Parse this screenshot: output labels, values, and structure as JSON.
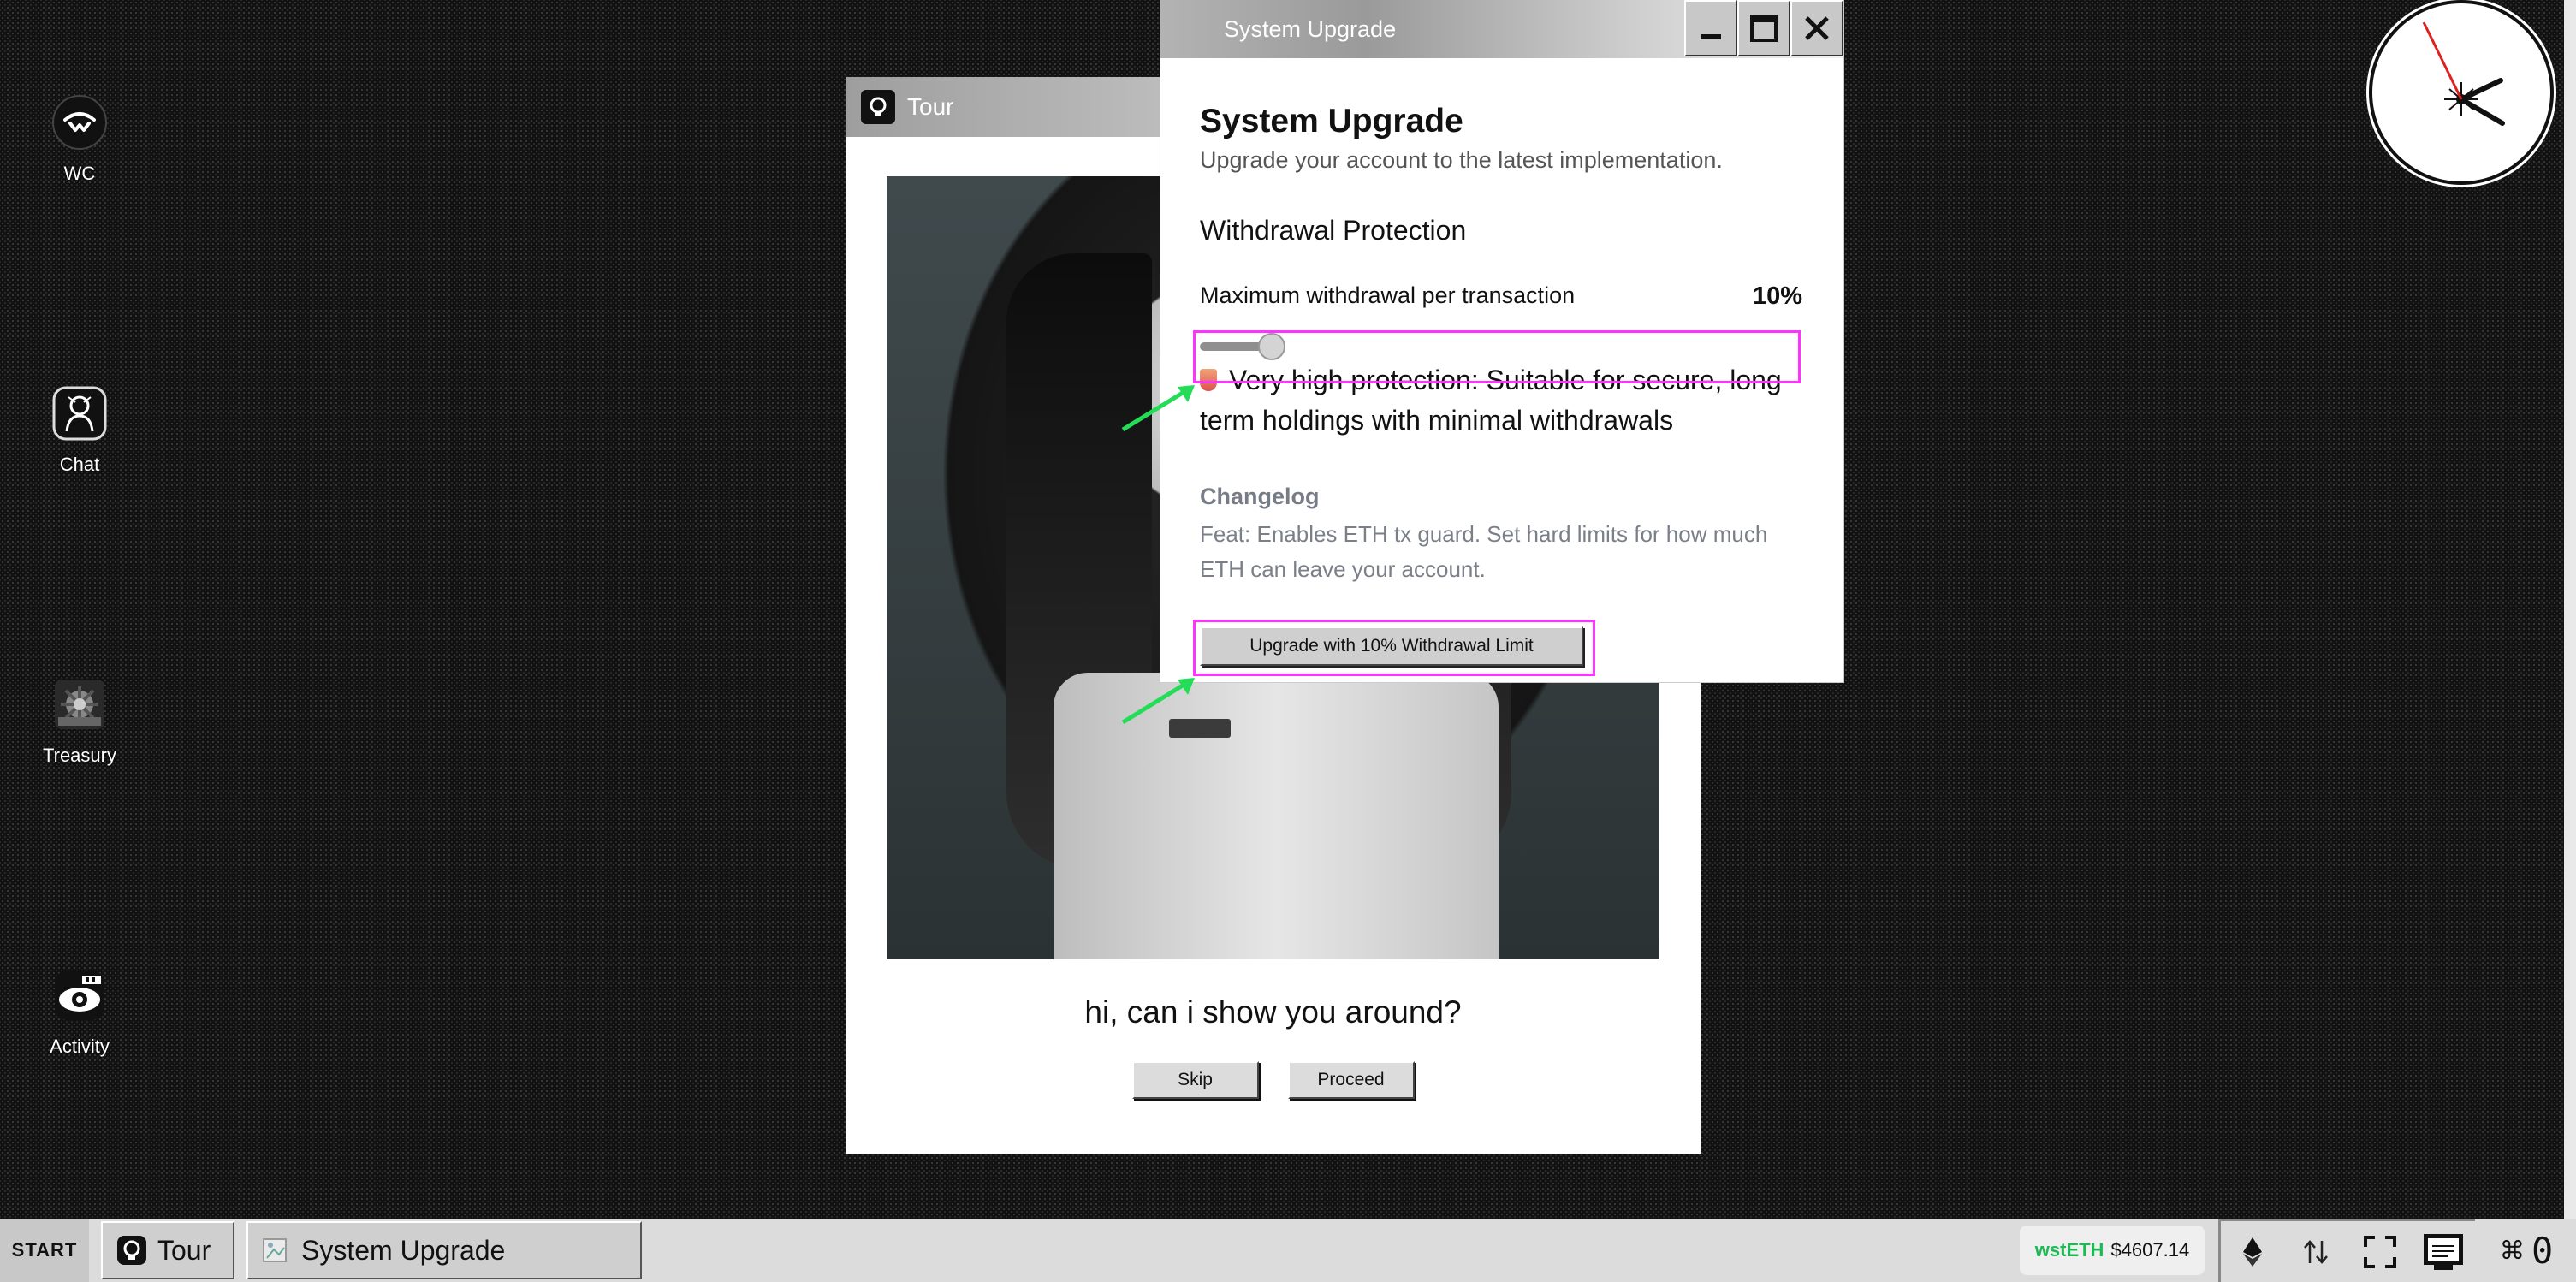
{
  "desktop": {
    "icons": [
      {
        "label": "WC",
        "icon": "walletconnect-icon"
      },
      {
        "label": "Chat",
        "icon": "chat-icon"
      },
      {
        "label": "Treasury",
        "icon": "treasury-icon"
      },
      {
        "label": "Activity",
        "icon": "activity-icon"
      }
    ]
  },
  "tour_window": {
    "title": "Tour",
    "caption": "hi, can i show you around?",
    "skip_label": "Skip",
    "proceed_label": "Proceed"
  },
  "upgrade_window": {
    "title": "System Upgrade",
    "heading": "System Upgrade",
    "subtitle": "Upgrade your account to the latest implementation.",
    "section_title": "Withdrawal Protection",
    "max_label": "Maximum withdrawal per transaction",
    "max_value": "10%",
    "slider_value_percent": 10,
    "protection_text": "Very high protection: Suitable for secure, long-term holdings with minimal withdrawals",
    "changelog_title": "Changelog",
    "changelog_text": "Feat: Enables ETH tx guard. Set hard limits for how much ETH can leave your account.",
    "upgrade_button": "Upgrade with 10% Withdrawal Limit"
  },
  "taskbar": {
    "start_label": "START",
    "items": [
      {
        "label": "Tour"
      },
      {
        "label": "System Upgrade"
      }
    ],
    "token_symbol": "wstETH",
    "token_price": "$4607.14",
    "cmd_symbol": "⌘",
    "cmd_count": "0"
  },
  "colors": {
    "highlight": "#ff33ff",
    "arrow": "#22dd55",
    "token": "#1db954"
  }
}
